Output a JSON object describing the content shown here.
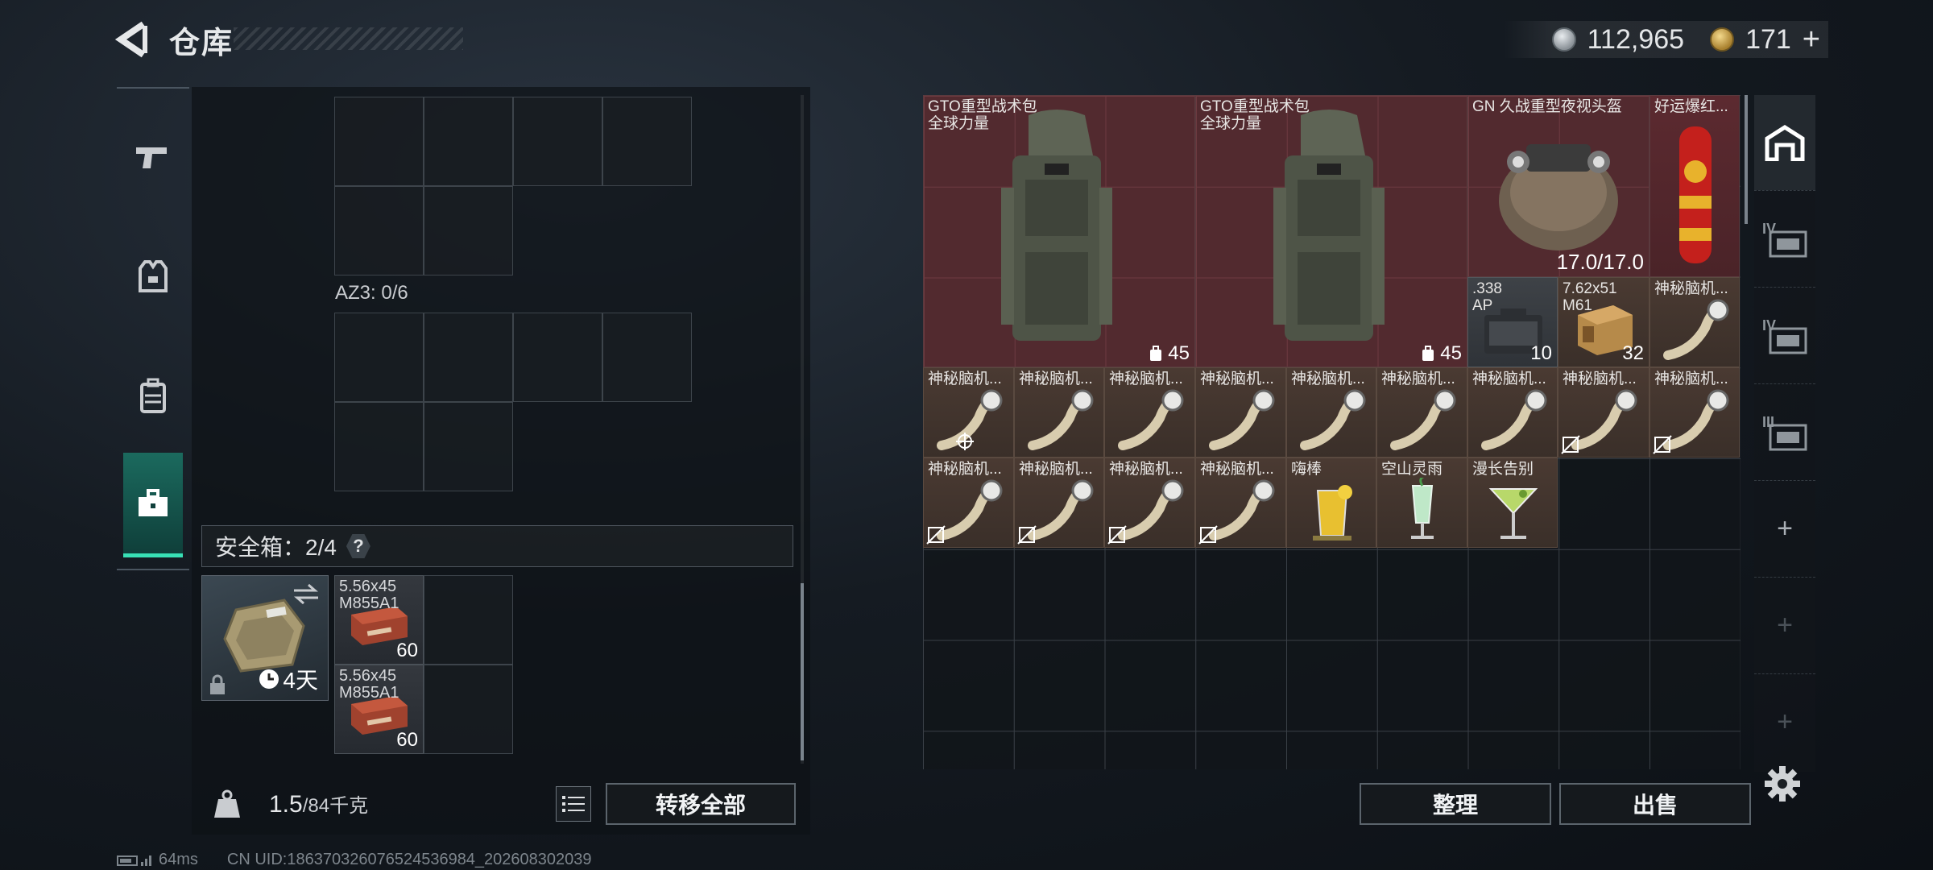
{
  "header": {
    "title": "仓库"
  },
  "currency": {
    "primary": "112,965",
    "secondary": "171",
    "plus": "+"
  },
  "left": {
    "az3_label": "AZ3: 0/6",
    "safebox_label": "安全箱：2/4",
    "safebox_help": "?",
    "safebox_days": "4天",
    "ammo": [
      {
        "name_line1": "5.56x45",
        "name_line2": "M855A1",
        "count": "60"
      },
      {
        "name_line1": "5.56x45",
        "name_line2": "M855A1",
        "count": "60"
      }
    ],
    "weight_value": "1.5",
    "weight_max": "/84千克",
    "transfer_all": "转移全部"
  },
  "stash": {
    "items": [
      {
        "name_line1": "GTO重型战术包",
        "name_line2": "全球力量",
        "count": "45"
      },
      {
        "name_line1": "GTO重型战术包",
        "name_line2": "全球力量",
        "count": "45"
      },
      {
        "name_line1": "GN 久战重型夜视头盔",
        "durability": "17.0/17.0"
      },
      {
        "name_line1": "好运爆红..."
      },
      {
        "name_line1": ".338",
        "name_line2": "AP",
        "count": "10"
      },
      {
        "name_line1": "7.62x51",
        "name_line2": "M61",
        "count": "32"
      },
      {
        "name_line1": "神秘脑机..."
      },
      {
        "name_line1": "神秘脑机..."
      },
      {
        "name_line1": "神秘脑机..."
      },
      {
        "name_line1": "神秘脑机..."
      },
      {
        "name_line1": "神秘脑机..."
      },
      {
        "name_line1": "神秘脑机..."
      },
      {
        "name_line1": "神秘脑机..."
      },
      {
        "name_line1": "神秘脑机..."
      },
      {
        "name_line1": "神秘脑机..."
      },
      {
        "name_line1": "神秘脑机..."
      },
      {
        "name_line1": "神秘脑机..."
      },
      {
        "name_line1": "神秘脑机..."
      },
      {
        "name_line1": "神秘脑机..."
      },
      {
        "name_line1": "神秘脑机..."
      },
      {
        "name_line1": "嗨棒"
      },
      {
        "name_line1": "空山灵雨"
      },
      {
        "name_line1": "漫长告别"
      }
    ],
    "sort_button": "整理",
    "sell_button": "出售"
  },
  "filters": {
    "tier_labels": [
      "IV",
      "IV",
      "III"
    ],
    "add": "+"
  },
  "status": {
    "ping": "64ms",
    "uid": "CN UID:186370326076524536984_202608302039"
  },
  "colors": {
    "accent": "#38e0b5",
    "rare_red": "#5c2a30",
    "common_brown": "#4a3a32"
  }
}
